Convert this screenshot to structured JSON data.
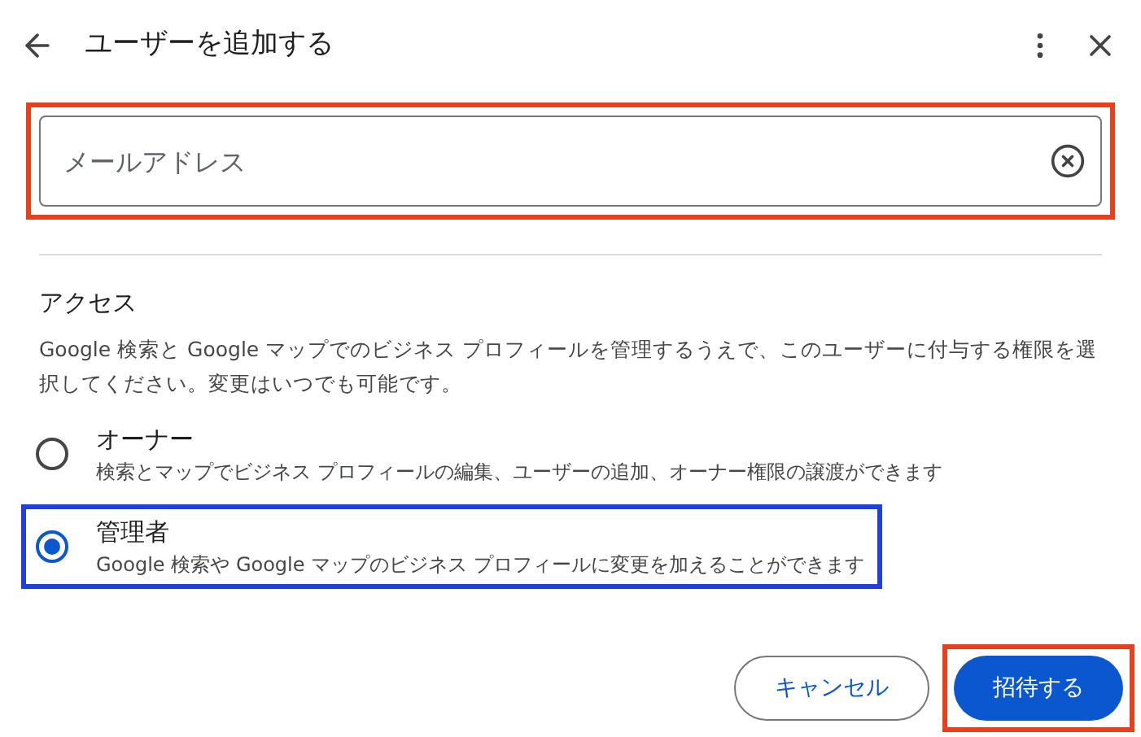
{
  "dialog": {
    "title": "ユーザーを追加する"
  },
  "email_field": {
    "placeholder": "メールアドレス",
    "color": "#e8401c"
  },
  "access": {
    "heading": "アクセス",
    "description": "Google 検索と Google マップでのビジネス プロフィールを管理するうえで、このユーザーに付与する権限を選択してください。変更はいつでも可能です。"
  },
  "roles": [
    {
      "label": "オーナー",
      "description": "検索とマップでビジネス プロフィールの編集、ユーザーの追加、オーナー権限の譲渡ができます",
      "selected": false
    },
    {
      "label": "管理者",
      "description": "Google 検索や Google マップのビジネス プロフィールに変更を加えることができます",
      "selected": true,
      "color": "#1f3fe0"
    }
  ],
  "buttons": [
    {
      "label": "キャンセル",
      "kind": "outline"
    },
    {
      "label": "招待する",
      "kind": "primary",
      "color": "#e8401c"
    }
  ]
}
